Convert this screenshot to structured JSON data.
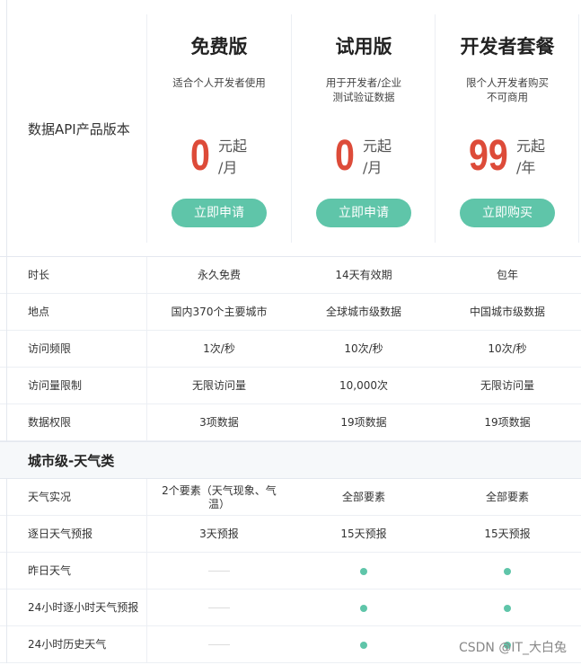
{
  "header": {
    "row_label": "数据API产品版本",
    "plans": [
      {
        "name": "免费版",
        "desc_line1": "适合个人开发者使用",
        "desc_line2": "",
        "price": "0",
        "unit_top": "元起",
        "unit_bottom": "/月",
        "button": "立即申请"
      },
      {
        "name": "试用版",
        "desc_line1": "用于开发者/企业",
        "desc_line2": "测试验证数据",
        "price": "0",
        "unit_top": "元起",
        "unit_bottom": "/月",
        "button": "立即申请"
      },
      {
        "name": "开发者套餐",
        "desc_line1": "限个人开发者购买",
        "desc_line2": "不可商用",
        "price": "99",
        "unit_top": "元起",
        "unit_bottom": "/年",
        "button": "立即购买"
      }
    ]
  },
  "basic_rows": [
    {
      "label": "时长",
      "values": [
        "永久免费",
        "14天有效期",
        "包年"
      ]
    },
    {
      "label": "地点",
      "values": [
        "国内370个主要城市",
        "全球城市级数据",
        "中国城市级数据"
      ]
    },
    {
      "label": "访问频限",
      "values": [
        "1次/秒",
        "10次/秒",
        "10次/秒"
      ]
    },
    {
      "label": "访问量限制",
      "values": [
        "无限访问量",
        "10,000次",
        "无限访问量"
      ]
    },
    {
      "label": "数据权限",
      "values": [
        "3项数据",
        "19项数据",
        "19项数据"
      ]
    }
  ],
  "section_title": "城市级-天气类",
  "weather_rows": [
    {
      "label": "天气实况",
      "values": [
        "2个要素（天气现象、气温）",
        "全部要素",
        "全部要素"
      ]
    },
    {
      "label": "逐日天气预报",
      "values": [
        "3天预报",
        "15天预报",
        "15天预报"
      ]
    },
    {
      "label": "昨日天气",
      "values": [
        "—",
        "●",
        "●"
      ]
    },
    {
      "label": "24小时逐小时天气预报",
      "values": [
        "—",
        "●",
        "●"
      ]
    },
    {
      "label": "24小时历史天气",
      "values": [
        "—",
        "●",
        "●"
      ]
    }
  ],
  "watermark": "CSDN @IT_大白兔",
  "colors": {
    "accent": "#5fc5a9",
    "price": "#dd4b39"
  }
}
